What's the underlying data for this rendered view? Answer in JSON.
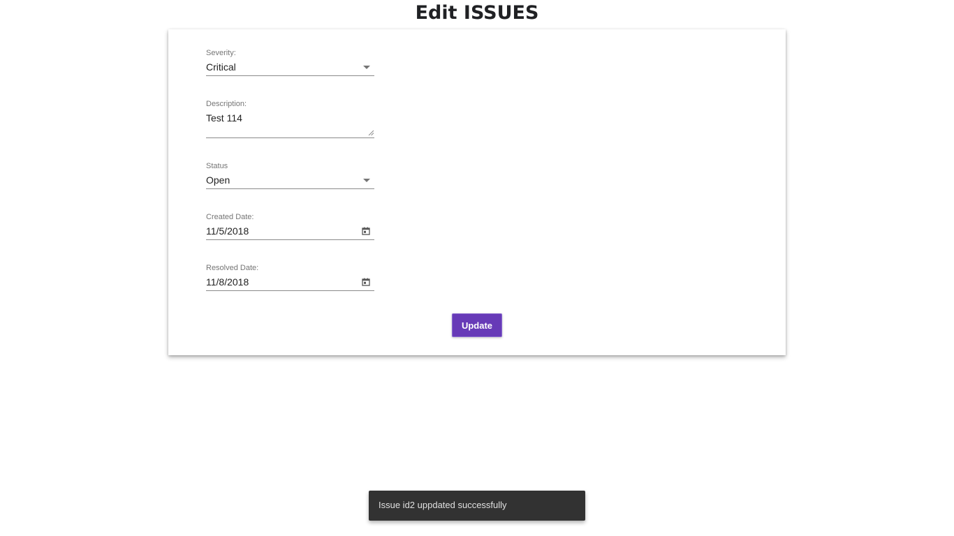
{
  "page": {
    "title": "Edit ISSUES"
  },
  "form": {
    "severity": {
      "label": "Severity:",
      "value": "Critical",
      "icon": "dropdown-caret-icon"
    },
    "description": {
      "label": "Description:",
      "value": "Test 114"
    },
    "status": {
      "label": "Status",
      "value": "Open",
      "icon": "dropdown-caret-icon"
    },
    "created_date": {
      "label": "Created Date:",
      "value": "11/5/2018",
      "icon": "calendar-icon"
    },
    "resolved_date": {
      "label": "Resolved Date:",
      "value": "11/8/2018",
      "icon": "calendar-icon"
    },
    "update_button": {
      "label": "Update"
    }
  },
  "snackbar": {
    "message": "Issue id2 uppdated successfully"
  },
  "colors": {
    "accent": "#673ab7",
    "snackbar_background": "#323232",
    "field_underline": "#8a8a8a"
  }
}
